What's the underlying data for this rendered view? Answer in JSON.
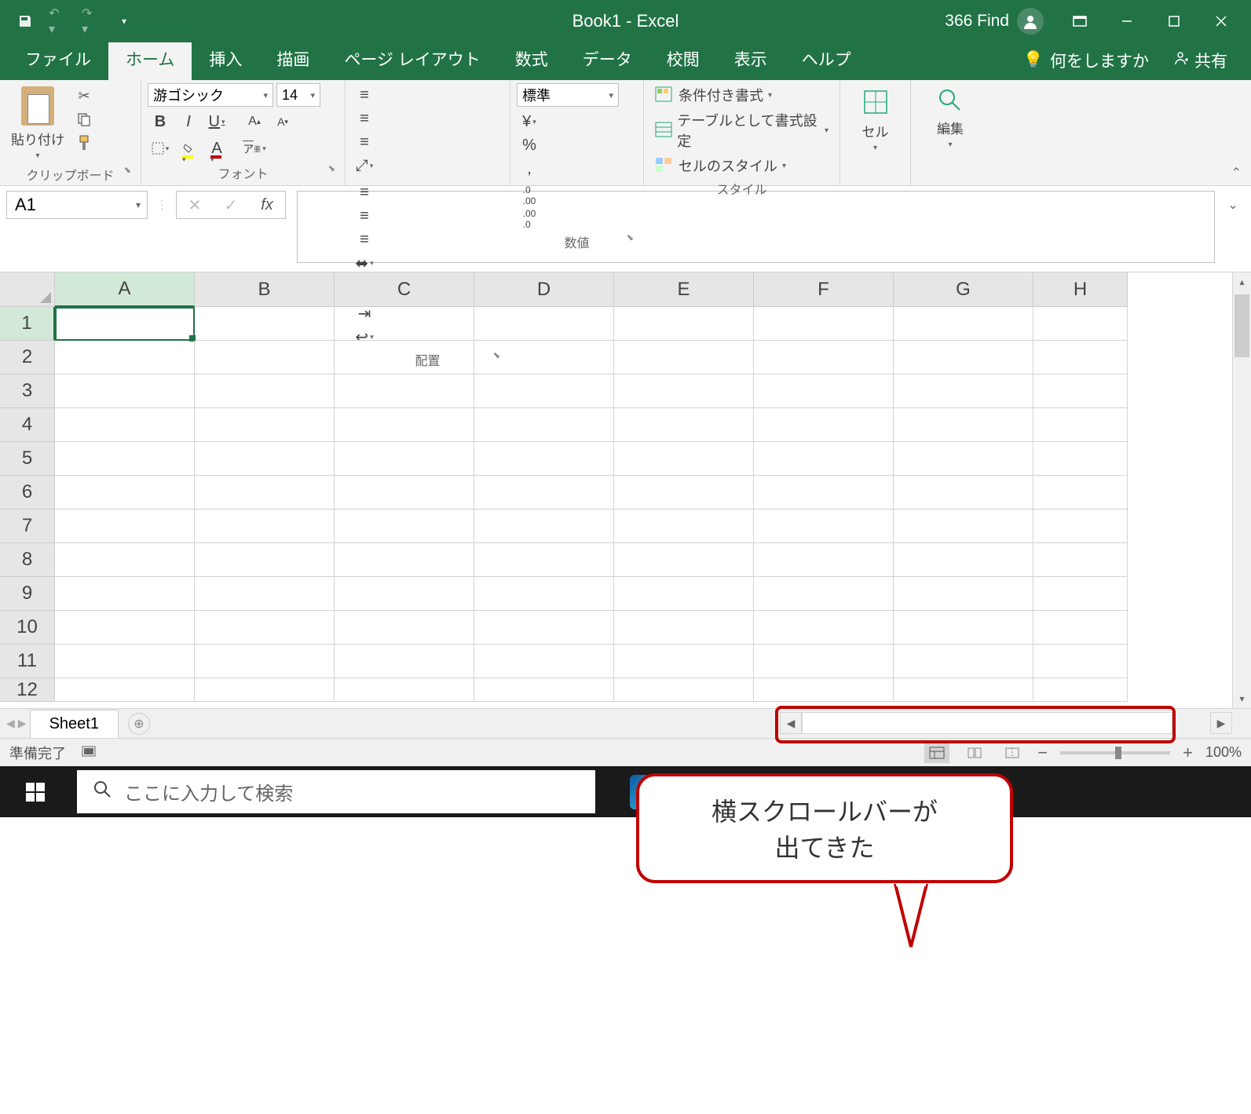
{
  "titlebar": {
    "title": "Book1  -  Excel",
    "user": "366 Find"
  },
  "tabs": {
    "file": "ファイル",
    "home": "ホーム",
    "insert": "挿入",
    "draw": "描画",
    "pagelayout": "ページ レイアウト",
    "formulas": "数式",
    "data": "データ",
    "review": "校閲",
    "view": "表示",
    "help": "ヘルプ",
    "tellme": "何をしますか",
    "share": "共有"
  },
  "ribbon": {
    "clipboard": {
      "label": "クリップボード",
      "paste": "貼り付け"
    },
    "font": {
      "label": "フォント",
      "name": "游ゴシック",
      "size": "14"
    },
    "alignment": {
      "label": "配置"
    },
    "number": {
      "label": "数値",
      "format": "標準"
    },
    "styles": {
      "label": "スタイル",
      "conditional": "条件付き書式",
      "table": "テーブルとして書式設定",
      "cell": "セルのスタイル"
    },
    "cells": {
      "label": "セル"
    },
    "editing": {
      "label": "編集"
    }
  },
  "formulabar": {
    "namebox": "A1"
  },
  "grid": {
    "columns": [
      "A",
      "B",
      "C",
      "D",
      "E",
      "F",
      "G",
      "H"
    ],
    "rows": [
      "1",
      "2",
      "3",
      "4",
      "5",
      "6",
      "7",
      "8",
      "9",
      "10",
      "11",
      "12"
    ],
    "selected": "A1"
  },
  "annotation": {
    "line1": "横スクロールバーが",
    "line2": "出てきた"
  },
  "sheets": {
    "tab1": "Sheet1"
  },
  "status": {
    "ready": "準備完了",
    "zoom": "100%"
  },
  "taskbar": {
    "search_placeholder": "ここに入力して検索"
  }
}
